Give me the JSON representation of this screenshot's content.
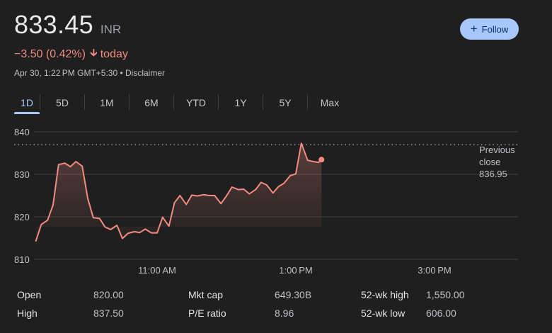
{
  "quote": {
    "price": "833.45",
    "currency": "INR",
    "change": "−3.50 (0.42%)",
    "change_period": "today",
    "timestamp": "Apr 30, 1:22 PM GMT+5:30 • Disclaimer",
    "change_color": "#f28b82"
  },
  "follow_button": {
    "label": "Follow",
    "icon": "plus-icon"
  },
  "tabs": [
    {
      "label": "1D",
      "active": true
    },
    {
      "label": "5D",
      "active": false
    },
    {
      "label": "1M",
      "active": false
    },
    {
      "label": "6M",
      "active": false
    },
    {
      "label": "YTD",
      "active": false
    },
    {
      "label": "1Y",
      "active": false
    },
    {
      "label": "5Y",
      "active": false
    },
    {
      "label": "Max",
      "active": false
    }
  ],
  "chart_data": {
    "type": "area",
    "ylim": [
      810,
      840
    ],
    "y_ticks": [
      "840",
      "830",
      "820",
      "810"
    ],
    "y_tick_values": [
      840,
      830,
      820,
      810
    ],
    "x_range_hours": [
      9.25,
      15.5
    ],
    "x_ticks": [
      "11:00 AM",
      "1:00 PM",
      "3:00 PM"
    ],
    "x_tick_values": [
      11,
      13,
      15
    ],
    "previous_close": {
      "label_line1": "Previous",
      "label_line2": "close",
      "value": "836.95",
      "numeric": 836.95
    },
    "line_color": "#f28b82",
    "series": [
      {
        "x": 9.25,
        "y": 814.2
      },
      {
        "x": 9.33,
        "y": 818.2
      },
      {
        "x": 9.42,
        "y": 819.2
      },
      {
        "x": 9.5,
        "y": 822.8
      },
      {
        "x": 9.58,
        "y": 832.3
      },
      {
        "x": 9.67,
        "y": 832.6
      },
      {
        "x": 9.75,
        "y": 831.8
      },
      {
        "x": 9.83,
        "y": 833.0
      },
      {
        "x": 9.92,
        "y": 831.9
      },
      {
        "x": 10.0,
        "y": 824.3
      },
      {
        "x": 10.08,
        "y": 819.8
      },
      {
        "x": 10.17,
        "y": 819.6
      },
      {
        "x": 10.25,
        "y": 817.6
      },
      {
        "x": 10.33,
        "y": 817.0
      },
      {
        "x": 10.42,
        "y": 818.0
      },
      {
        "x": 10.5,
        "y": 814.9
      },
      {
        "x": 10.58,
        "y": 816.1
      },
      {
        "x": 10.67,
        "y": 816.5
      },
      {
        "x": 10.75,
        "y": 816.3
      },
      {
        "x": 10.83,
        "y": 817.1
      },
      {
        "x": 10.92,
        "y": 816.2
      },
      {
        "x": 11.0,
        "y": 816.2
      },
      {
        "x": 11.08,
        "y": 819.9
      },
      {
        "x": 11.17,
        "y": 817.8
      },
      {
        "x": 11.25,
        "y": 823.3
      },
      {
        "x": 11.33,
        "y": 825.0
      },
      {
        "x": 11.42,
        "y": 822.9
      },
      {
        "x": 11.5,
        "y": 825.1
      },
      {
        "x": 11.58,
        "y": 824.9
      },
      {
        "x": 11.67,
        "y": 825.2
      },
      {
        "x": 11.75,
        "y": 825.0
      },
      {
        "x": 11.83,
        "y": 825.0
      },
      {
        "x": 11.92,
        "y": 823.1
      },
      {
        "x": 12.0,
        "y": 824.9
      },
      {
        "x": 12.08,
        "y": 827.0
      },
      {
        "x": 12.17,
        "y": 826.4
      },
      {
        "x": 12.25,
        "y": 826.5
      },
      {
        "x": 12.33,
        "y": 825.4
      },
      {
        "x": 12.42,
        "y": 826.4
      },
      {
        "x": 12.5,
        "y": 828.1
      },
      {
        "x": 12.58,
        "y": 827.5
      },
      {
        "x": 12.67,
        "y": 825.6
      },
      {
        "x": 12.75,
        "y": 827.1
      },
      {
        "x": 12.83,
        "y": 827.9
      },
      {
        "x": 12.92,
        "y": 829.7
      },
      {
        "x": 13.0,
        "y": 830.1
      },
      {
        "x": 13.08,
        "y": 837.3
      },
      {
        "x": 13.17,
        "y": 833.3
      },
      {
        "x": 13.25,
        "y": 833.0
      },
      {
        "x": 13.33,
        "y": 832.8
      },
      {
        "x": 13.37,
        "y": 833.45
      }
    ]
  },
  "stats": {
    "rows": [
      [
        {
          "label": "Open",
          "value": "820.00"
        },
        {
          "label": "Mkt cap",
          "value": "649.30B"
        },
        {
          "label": "52-wk high",
          "value": "1,550.00"
        }
      ],
      [
        {
          "label": "High",
          "value": "837.50"
        },
        {
          "label": "P/E ratio",
          "value": "8.96"
        },
        {
          "label": "52-wk low",
          "value": "606.00"
        }
      ]
    ]
  }
}
